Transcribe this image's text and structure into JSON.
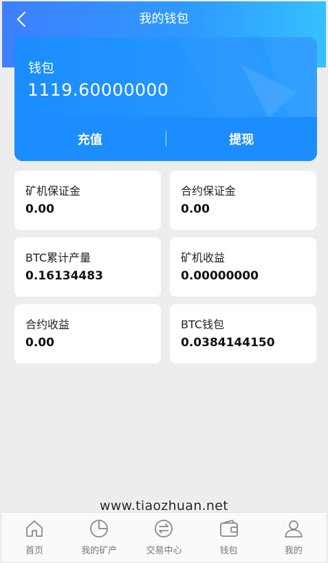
{
  "header": {
    "title": "我的钱包"
  },
  "wallet": {
    "label": "钱包",
    "balance": "1119.60000000",
    "recharge_label": "充值",
    "withdraw_label": "提现"
  },
  "stats": [
    {
      "label": "矿机保证金",
      "value": "0.00"
    },
    {
      "label": "合约保证金",
      "value": "0.00"
    },
    {
      "label": "BTC累计产量",
      "value": "0.16134483"
    },
    {
      "label": "矿机收益",
      "value": "0.00000000"
    },
    {
      "label": "合约收益",
      "value": "0.00"
    },
    {
      "label": "BTC钱包",
      "value": "0.0384144150"
    }
  ],
  "watermark": "www.tiaozhuan.net",
  "tabbar": {
    "items": [
      {
        "label": "首页",
        "icon": "home-icon"
      },
      {
        "label": "我的矿产",
        "icon": "pie-chart-icon"
      },
      {
        "label": "交易中心",
        "icon": "exchange-icon"
      },
      {
        "label": "钱包",
        "icon": "wallet-icon"
      },
      {
        "label": "我的",
        "icon": "user-icon"
      }
    ]
  },
  "colors": {
    "header_gradient_start": "#3d7fff",
    "header_gradient_end": "#35c0ff",
    "card_blue": "#1a8cff",
    "background": "#ededed"
  }
}
